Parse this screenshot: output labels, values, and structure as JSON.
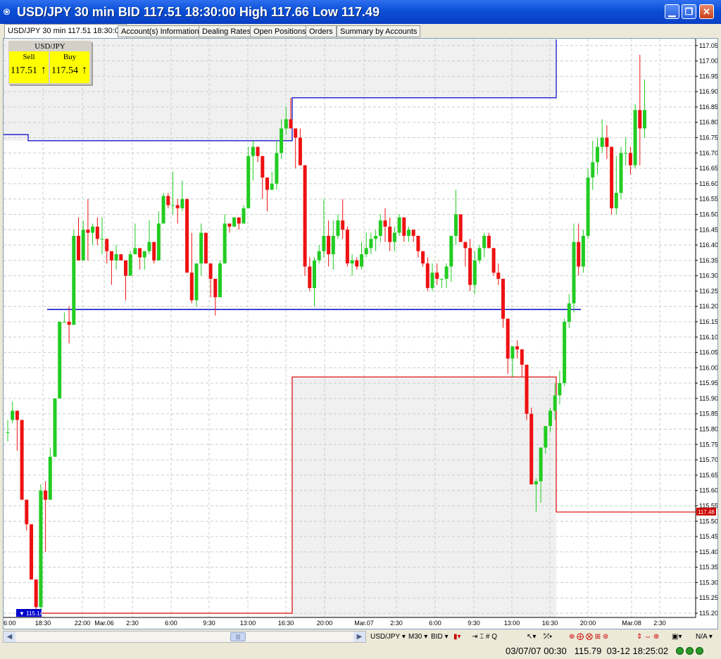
{
  "window": {
    "title": "USD/JPY 30 min BID 117.51 18:30:00 High 117.66 Low 117.49",
    "icon": "app-logo-icon"
  },
  "tabs": [
    {
      "label": "USD/JPY 30 min 117.51 18:30:00",
      "active": true
    },
    {
      "label": "Account(s) Information"
    },
    {
      "label": "Dealing Rates"
    },
    {
      "label": "Open Positions"
    },
    {
      "label": "Orders"
    },
    {
      "label": "Summary by Accounts"
    }
  ],
  "quote_box": {
    "symbol": "USD/JPY",
    "sell_label": "Sell",
    "buy_label": "Buy",
    "sell_price": "117.51",
    "buy_price": "117.54",
    "arrow": "↑",
    "color": "#ffff00"
  },
  "chart_data": {
    "type": "candlestick",
    "symbol": "USD/JPY",
    "ylim": [
      115.18,
      117.07
    ],
    "y_ticks": [
      "117.05",
      "117.00",
      "116.95",
      "116.90",
      "116.85",
      "116.80",
      "116.75",
      "116.70",
      "116.65",
      "116.60",
      "116.55",
      "116.50",
      "116.45",
      "116.40",
      "116.35",
      "116.30",
      "116.25",
      "116.20",
      "116.15",
      "116.10",
      "116.05",
      "116.00",
      "115.95",
      "115.90",
      "115.85",
      "115.80",
      "115.75",
      "115.70",
      "115.65",
      "115.60",
      "115.55",
      "115.50",
      "115.45",
      "115.40",
      "115.35",
      "115.30",
      "115.25",
      "115.20"
    ],
    "x_ticks": [
      "6:00",
      "18:30",
      "22:00",
      "Mar.06",
      "2:30",
      "6:00",
      "9:30",
      "13:00",
      "16:30",
      "20:00",
      "Mar.07",
      "2:30",
      "6:00",
      "9:30",
      "13:00",
      "16:30",
      "20:00",
      "Mar.08",
      "2:30"
    ],
    "up_color": "#22cc22",
    "down_color": "#ee1111",
    "candles": [
      [
        115.79,
        115.83,
        115.76,
        115.79
      ],
      [
        115.83,
        115.89,
        115.82,
        115.86
      ],
      [
        115.86,
        115.86,
        115.73,
        115.83
      ],
      [
        115.83,
        115.83,
        115.57,
        115.57
      ],
      [
        115.57,
        115.57,
        115.47,
        115.49
      ],
      [
        115.49,
        115.49,
        115.31,
        115.31
      ],
      [
        115.31,
        115.31,
        115.2,
        115.22
      ],
      [
        115.22,
        115.62,
        115.2,
        115.6
      ],
      [
        115.6,
        115.63,
        115.4,
        115.57
      ],
      [
        115.57,
        115.74,
        115.57,
        115.71
      ],
      [
        115.71,
        115.9,
        115.71,
        115.9
      ],
      [
        115.9,
        116.15,
        115.9,
        116.15
      ],
      [
        116.15,
        116.18,
        116.15,
        116.15
      ],
      [
        116.15,
        116.2,
        116.08,
        116.14
      ],
      [
        116.14,
        116.45,
        116.14,
        116.43
      ],
      [
        116.43,
        116.49,
        116.35,
        116.35
      ],
      [
        116.35,
        116.48,
        116.35,
        116.45
      ],
      [
        116.45,
        116.55,
        116.35,
        116.44
      ],
      [
        116.44,
        116.47,
        116.4,
        116.46
      ],
      [
        116.46,
        116.49,
        116.4,
        116.42
      ],
      [
        116.42,
        116.49,
        116.37,
        116.42
      ],
      [
        116.42,
        116.42,
        116.34,
        116.38
      ],
      [
        116.38,
        116.38,
        116.27,
        116.35
      ],
      [
        116.35,
        116.4,
        116.32,
        116.37
      ],
      [
        116.37,
        116.37,
        116.35,
        116.35
      ],
      [
        116.35,
        116.35,
        116.22,
        116.3
      ],
      [
        116.3,
        116.38,
        116.3,
        116.37
      ],
      [
        116.37,
        116.47,
        116.37,
        116.39
      ],
      [
        116.39,
        116.39,
        116.32,
        116.36
      ],
      [
        116.36,
        116.38,
        116.32,
        116.38
      ],
      [
        116.38,
        116.48,
        116.37,
        116.41
      ],
      [
        116.41,
        116.41,
        116.34,
        116.35
      ],
      [
        116.35,
        116.51,
        116.35,
        116.47
      ],
      [
        116.47,
        116.57,
        116.47,
        116.56
      ],
      [
        116.56,
        116.57,
        116.52,
        116.53
      ],
      [
        116.53,
        116.64,
        116.5,
        116.53
      ],
      [
        116.53,
        116.55,
        116.47,
        116.52
      ],
      [
        116.52,
        116.61,
        116.51,
        116.55
      ],
      [
        116.55,
        116.55,
        116.31,
        116.31
      ],
      [
        116.31,
        116.44,
        116.21,
        116.22
      ],
      [
        116.22,
        116.34,
        116.2,
        116.34
      ],
      [
        116.34,
        116.47,
        116.3,
        116.44
      ],
      [
        116.44,
        116.44,
        116.34,
        116.34
      ],
      [
        116.34,
        116.34,
        116.23,
        116.29
      ],
      [
        116.29,
        116.29,
        116.17,
        116.23
      ],
      [
        116.23,
        116.35,
        116.23,
        116.34
      ],
      [
        116.34,
        116.5,
        116.34,
        116.47
      ],
      [
        116.47,
        116.47,
        116.44,
        116.46
      ],
      [
        116.46,
        116.49,
        116.46,
        116.49
      ],
      [
        116.49,
        116.49,
        116.45,
        116.47
      ],
      [
        116.47,
        116.53,
        116.47,
        116.52
      ],
      [
        116.52,
        116.72,
        116.52,
        116.69
      ],
      [
        116.69,
        116.74,
        116.61,
        116.72
      ],
      [
        116.72,
        116.72,
        116.67,
        116.69
      ],
      [
        116.69,
        116.69,
        116.55,
        116.62
      ],
      [
        116.62,
        116.62,
        116.51,
        116.58
      ],
      [
        116.58,
        116.64,
        116.58,
        116.6
      ],
      [
        116.6,
        116.74,
        116.58,
        116.7
      ],
      [
        116.7,
        116.81,
        116.68,
        116.78
      ],
      [
        116.78,
        116.85,
        116.76,
        116.81
      ],
      [
        116.81,
        116.88,
        116.78,
        116.78
      ],
      [
        116.78,
        116.78,
        116.65,
        116.75
      ],
      [
        116.75,
        116.78,
        116.66,
        116.66
      ],
      [
        116.66,
        116.66,
        116.3,
        116.33
      ],
      [
        116.33,
        116.36,
        116.25,
        116.26
      ],
      [
        116.26,
        116.36,
        116.2,
        116.35
      ],
      [
        116.35,
        116.4,
        116.34,
        116.38
      ],
      [
        116.38,
        116.55,
        116.36,
        116.43
      ],
      [
        116.43,
        116.48,
        116.33,
        116.37
      ],
      [
        116.37,
        116.48,
        116.32,
        116.43
      ],
      [
        116.43,
        116.5,
        116.42,
        116.48
      ],
      [
        116.48,
        116.55,
        116.42,
        116.45
      ],
      [
        116.45,
        116.46,
        116.33,
        116.34
      ],
      [
        116.34,
        116.37,
        116.3,
        116.35
      ],
      [
        116.35,
        116.36,
        116.32,
        116.33
      ],
      [
        116.33,
        116.41,
        116.32,
        116.37
      ],
      [
        116.37,
        116.44,
        116.36,
        116.39
      ],
      [
        116.39,
        116.44,
        116.37,
        116.42
      ],
      [
        116.42,
        116.45,
        116.38,
        116.43
      ],
      [
        116.43,
        116.5,
        116.41,
        116.48
      ],
      [
        116.48,
        116.52,
        116.41,
        116.46
      ],
      [
        116.46,
        116.49,
        116.38,
        116.41
      ],
      [
        116.41,
        116.46,
        116.38,
        116.44
      ],
      [
        116.44,
        116.5,
        116.43,
        116.49
      ],
      [
        116.49,
        116.49,
        116.41,
        116.43
      ],
      [
        116.43,
        116.46,
        116.41,
        116.45
      ],
      [
        116.45,
        116.45,
        116.41,
        116.43
      ],
      [
        116.43,
        116.43,
        116.36,
        116.38
      ],
      [
        116.38,
        116.38,
        116.33,
        116.34
      ],
      [
        116.34,
        116.36,
        116.25,
        116.26
      ],
      [
        116.26,
        116.34,
        116.25,
        116.31
      ],
      [
        116.31,
        116.34,
        116.27,
        116.29
      ],
      [
        116.29,
        116.29,
        116.26,
        116.29
      ],
      [
        116.29,
        116.34,
        116.26,
        116.33
      ],
      [
        116.33,
        116.43,
        116.28,
        116.43
      ],
      [
        116.43,
        116.58,
        116.4,
        116.5
      ],
      [
        116.5,
        116.5,
        116.41,
        116.41
      ],
      [
        116.41,
        116.41,
        116.33,
        116.39
      ],
      [
        116.39,
        116.42,
        116.25,
        116.27
      ],
      [
        116.27,
        116.38,
        116.24,
        116.35
      ],
      [
        116.35,
        116.4,
        116.34,
        116.39
      ],
      [
        116.39,
        116.44,
        116.36,
        116.43
      ],
      [
        116.43,
        116.44,
        116.39,
        116.39
      ],
      [
        116.39,
        116.39,
        116.3,
        116.31
      ],
      [
        116.31,
        116.34,
        116.27,
        116.29
      ],
      [
        116.29,
        116.29,
        116.13,
        116.16
      ],
      [
        116.16,
        116.16,
        115.98,
        116.03
      ],
      [
        116.03,
        116.06,
        115.97,
        116.07
      ],
      [
        116.07,
        116.09,
        116.03,
        116.06
      ],
      [
        116.06,
        116.06,
        115.97,
        116.01
      ],
      [
        116.01,
        116.01,
        115.83,
        115.85
      ],
      [
        115.85,
        115.87,
        115.62,
        115.62
      ],
      [
        115.62,
        115.64,
        115.53,
        115.63
      ],
      [
        115.63,
        115.74,
        115.56,
        115.74
      ],
      [
        115.74,
        115.81,
        115.72,
        115.81
      ],
      [
        115.81,
        115.87,
        115.79,
        115.86
      ],
      [
        115.86,
        115.95,
        115.83,
        115.91
      ],
      [
        115.91,
        115.99,
        115.88,
        115.95
      ],
      [
        115.95,
        116.16,
        115.94,
        116.15
      ],
      [
        116.15,
        116.24,
        116.13,
        116.21
      ],
      [
        116.21,
        116.47,
        116.18,
        116.41
      ],
      [
        116.41,
        116.47,
        116.3,
        116.33
      ],
      [
        116.33,
        116.45,
        116.31,
        116.43
      ],
      [
        116.43,
        116.65,
        116.42,
        116.62
      ],
      [
        116.62,
        116.74,
        116.58,
        116.67
      ],
      [
        116.67,
        116.75,
        116.63,
        116.72
      ],
      [
        116.72,
        116.81,
        116.7,
        116.75
      ],
      [
        116.75,
        116.79,
        116.68,
        116.72
      ],
      [
        116.72,
        116.72,
        116.5,
        116.52
      ],
      [
        116.52,
        116.69,
        116.5,
        116.57
      ],
      [
        116.57,
        116.72,
        116.55,
        116.7
      ],
      [
        116.7,
        116.75,
        116.66,
        116.7
      ],
      [
        116.7,
        116.72,
        116.63,
        116.66
      ],
      [
        116.66,
        116.86,
        116.65,
        116.84
      ],
      [
        116.84,
        117.02,
        116.66,
        116.78
      ],
      [
        116.78,
        116.94,
        116.75,
        116.84
      ]
    ],
    "resistance_zone": {
      "color": "#0000cc",
      "steps": [
        [
          0,
          116.76
        ],
        [
          5,
          116.76
        ],
        [
          5,
          116.74
        ],
        [
          62,
          116.74
        ],
        [
          62,
          116.88
        ],
        [
          119,
          116.88
        ],
        [
          119,
          117.07
        ]
      ]
    },
    "support_zone": {
      "color": "#dd0000",
      "steps": [
        [
          5,
          115.2
        ],
        [
          62,
          115.2
        ],
        [
          62,
          115.97
        ],
        [
          119,
          115.97
        ],
        [
          119,
          115.53
        ],
        [
          145,
          115.53
        ]
      ]
    },
    "hline": {
      "value": 116.19,
      "color": "#0000cc"
    },
    "low_marker": "115.14",
    "current_price_label": "117.48"
  },
  "scroll_toolbar": {
    "symbol": "USD/JPY",
    "timeframe": "M30",
    "price_type": "BID",
    "zoom_value": "N/A",
    "icons": [
      "scroll-left-icon",
      "scroll-right-icon",
      "cursor-icon",
      "crosshair-icon",
      "zoom-icon"
    ]
  },
  "status": {
    "cursor_time": "03/07/07 00:30",
    "cursor_price": "115.79",
    "server_time": "03-12 18:25:02"
  }
}
